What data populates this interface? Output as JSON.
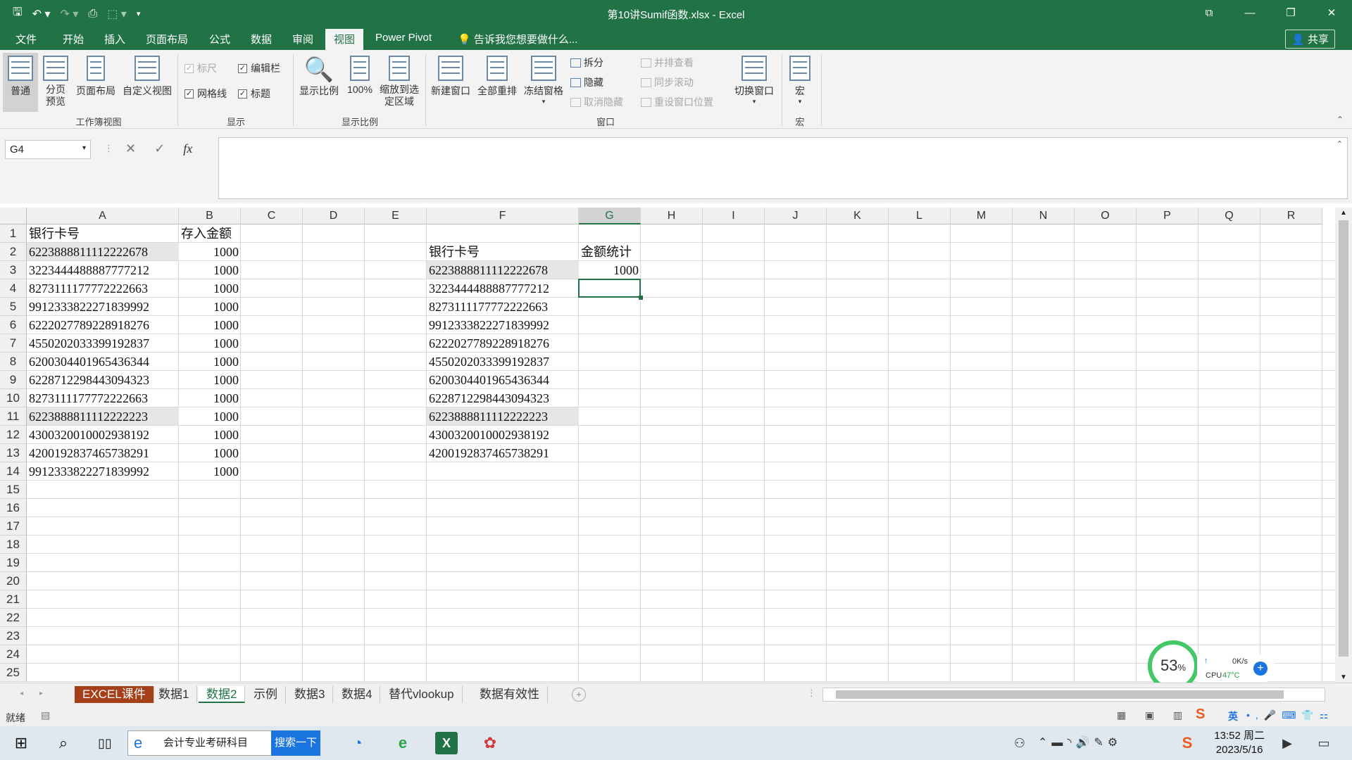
{
  "window": {
    "title": "第10讲Sumif函数.xlsx - Excel"
  },
  "menu": {
    "items": [
      "文件",
      "开始",
      "插入",
      "页面布局",
      "公式",
      "数据",
      "审阅",
      "视图",
      "Power Pivot"
    ],
    "active": "视图",
    "tell_me": "告诉我您想要做什么...",
    "share": "共享"
  },
  "ribbon": {
    "workbook_views": {
      "normal": "普通",
      "page_break": "分页预览",
      "page_layout": "页面布局",
      "custom_views": "自定义视图",
      "group": "工作簿视图"
    },
    "show": {
      "ruler": "标尺",
      "formula_bar": "编辑栏",
      "gridlines": "网格线",
      "headings": "标题",
      "group": "显示"
    },
    "zoom": {
      "zoom": "显示比例",
      "hundred": "100%",
      "zoom_to_selection": "缩放到选定区域",
      "group": "显示比例"
    },
    "window": {
      "new_window": "新建窗口",
      "arrange_all": "全部重排",
      "freeze_panes": "冻结窗格",
      "split": "拆分",
      "hide": "隐藏",
      "unhide": "取消隐藏",
      "side_by_side": "并排查看",
      "sync_scroll": "同步滚动",
      "reset_position": "重设窗口位置",
      "switch_windows": "切换窗口",
      "group": "窗口"
    },
    "macros": {
      "macros": "宏",
      "group": "宏"
    }
  },
  "formula_bar": {
    "name_box": "G4",
    "formula": ""
  },
  "columns": [
    "A",
    "B",
    "C",
    "D",
    "E",
    "F",
    "G",
    "H",
    "I",
    "J",
    "K",
    "L",
    "M",
    "N",
    "O",
    "P",
    "Q",
    "R"
  ],
  "rows": [
    "1",
    "2",
    "3",
    "4",
    "5",
    "6",
    "7",
    "8",
    "9",
    "10",
    "11",
    "12",
    "13",
    "14",
    "15",
    "16",
    "17",
    "18",
    "19",
    "20",
    "21",
    "22",
    "23",
    "24",
    "25"
  ],
  "sheet": {
    "A1": "银行卡号",
    "B1": "存入金额",
    "A": [
      "6223888811112222678",
      "3223444488887777212",
      "8273111177772222663",
      "9912333822271839992",
      "6222027789228918276",
      "4550202033399192837",
      "6200304401965436344",
      "6228712298443094323",
      "8273111177772222663",
      "6223888811112222223",
      "4300320010002938192",
      "4200192837465738291",
      "9912333822271839992"
    ],
    "B": [
      "1000",
      "1000",
      "1000",
      "1000",
      "1000",
      "1000",
      "1000",
      "1000",
      "1000",
      "1000",
      "1000",
      "1000",
      "1000"
    ],
    "F2": "银行卡号",
    "G2": "金额统计",
    "F": [
      "6223888811112222678",
      "3223444488887777212",
      "8273111177772222663",
      "9912333822271839992",
      "6222027789228918276",
      "4550202033399192837",
      "6200304401965436344",
      "6228712298443094323",
      "6223888811112222223",
      "4300320010002938192",
      "4200192837465738291"
    ],
    "G3": "1000"
  },
  "tabs": [
    "EXCEL课件",
    "数据1",
    "数据2",
    "示例",
    "数据3",
    "数据4",
    "替代vlookup",
    "数据有效性"
  ],
  "active_tab": "数据2",
  "status": {
    "ready": "就绪"
  },
  "perf": {
    "percent": "53",
    "unit": "%",
    "speed": "0K/s",
    "cpu": "CPU",
    "temp": "47°C"
  },
  "taskbar": {
    "search_text": "会计专业考研科目",
    "search_button": "搜索一下",
    "time": "13:52 周二",
    "date": "2023/5/16",
    "ime": "英"
  }
}
